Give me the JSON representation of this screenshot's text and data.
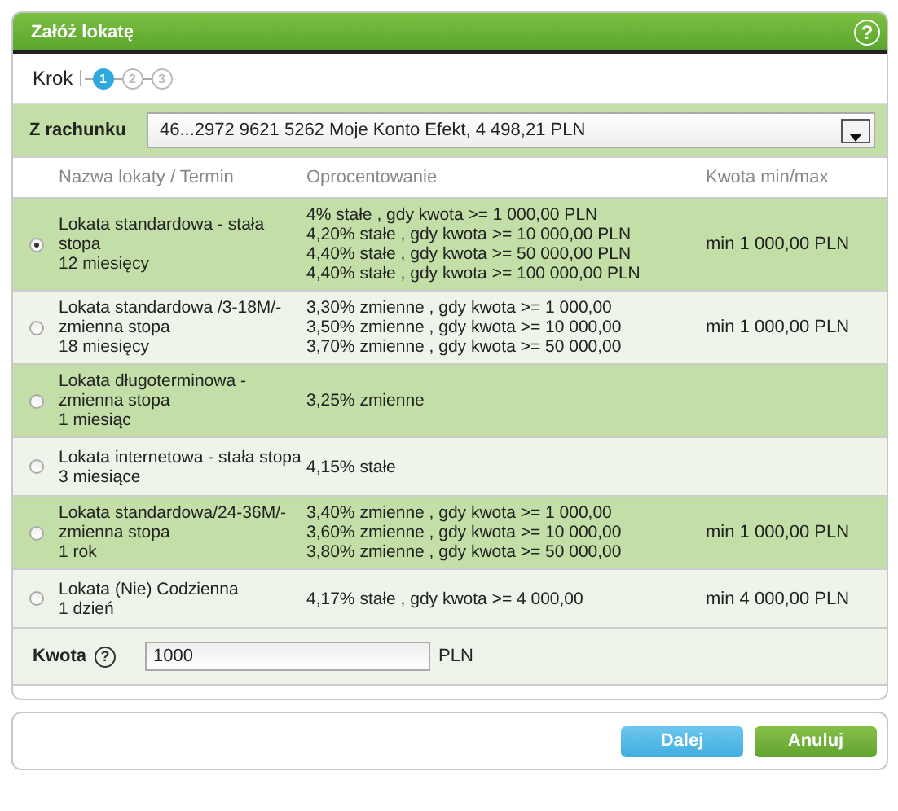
{
  "window": {
    "title": "Załóż lokatę",
    "help": "?"
  },
  "steps": {
    "label": "Krok",
    "items": [
      {
        "label": "1",
        "selected": true
      },
      {
        "label": "2",
        "selected": false
      },
      {
        "label": "3",
        "selected": false
      }
    ]
  },
  "account": {
    "label": "Z rachunku",
    "value": "46...2972 9621 5262 Moje Konto Efekt, 4 498,21 PLN"
  },
  "table": {
    "columns": [
      "Nazwa lokaty / Termin",
      "Oprocentowanie",
      "Kwota min/max"
    ],
    "rows": [
      {
        "selected": true,
        "name": "Lokata standardowa - stała stopa",
        "term": "12 miesięcy",
        "rates": [
          "4% stałe , gdy kwota >= 1 000,00  PLN",
          "4,20% stałe , gdy kwota >= 10 000,00  PLN",
          "4,40% stałe , gdy kwota >= 50 000,00  PLN",
          "4,40% stałe , gdy kwota >= 100 000,00  PLN"
        ],
        "amount": "min 1 000,00 PLN"
      },
      {
        "selected": false,
        "name": "Lokata standardowa /3-18M/- zmienna stopa",
        "term": "18 miesięcy",
        "rates": [
          "3,30% zmienne , gdy kwota >= 1 000,00",
          "3,50% zmienne , gdy kwota >= 10 000,00",
          "3,70% zmienne , gdy kwota >= 50 000,00"
        ],
        "amount": "min 1 000,00 PLN"
      },
      {
        "selected": false,
        "name": "Lokata długoterminowa - zmienna stopa",
        "term": "1 miesiąc",
        "rates": [
          "3,25% zmienne"
        ]
      },
      {
        "selected": false,
        "name": "Lokata internetowa - stała stopa",
        "term": "3 miesiące",
        "rates": [
          "4,15% stałe"
        ]
      },
      {
        "selected": false,
        "name": "Lokata standardowa/24-36M/- zmienna stopa",
        "term": "1 rok",
        "rates": [
          "3,40% zmienne , gdy kwota >= 1 000,00",
          "3,60% zmienne , gdy kwota >= 10 000,00",
          "3,80% zmienne , gdy kwota >= 50 000,00"
        ],
        "amount": "min 1 000,00 PLN"
      },
      {
        "selected": false,
        "name": "Lokata (Nie) Codzienna",
        "term": "1 dzień",
        "rates": [
          "4,17% stałe , gdy kwota >= 4 000,00"
        ],
        "amount": "min 4 000,00 PLN"
      }
    ]
  },
  "amount": {
    "label": "Kwota",
    "help": "?",
    "value": "1000",
    "unit": "PLN"
  },
  "buttons": [
    {
      "label": "Dalej",
      "kind": "primary"
    },
    {
      "label": "Anuluj",
      "kind": "cancel"
    }
  ]
}
